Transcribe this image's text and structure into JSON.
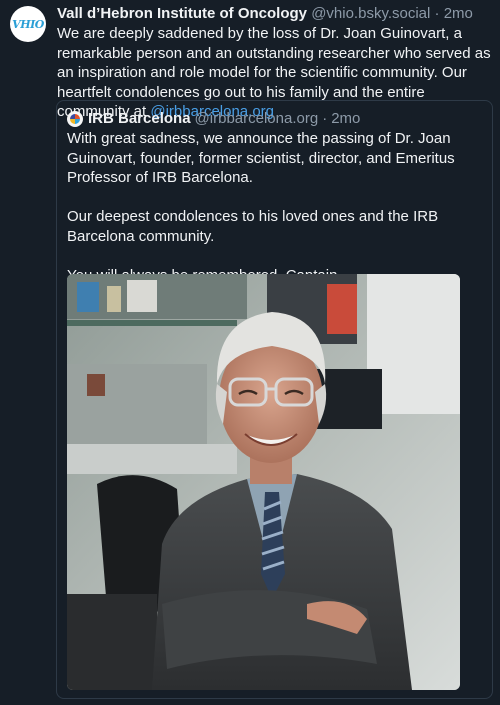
{
  "post": {
    "author": {
      "display_name": "Vall d’Hebron Institute of Oncology",
      "handle": "@vhio.bsky.social",
      "time": "2mo",
      "avatar_text": "VHIO"
    },
    "text_before_mention": "We are deeply saddened by the loss of Dr. Joan Guinovart, a remarkable person and an outstanding researcher who served as an inspiration and role model for the scientific community. Our heartfelt condolences go out to his family and the entire community at ",
    "mention": "@irbbarcelona.org",
    "separator": "·"
  },
  "quote": {
    "author": {
      "display_name": "IRB Barcelona",
      "handle": "@irbbarcelona.org",
      "time": "2mo"
    },
    "paragraphs": [
      "With great sadness, we announce the passing of Dr. Joan Guinovart, founder, former scientist, director, and Emeritus Professor of IRB Barcelona.",
      "Our deepest condolences to his loved ones and the IRB Barcelona community.",
      "You will always be remembered, Captain."
    ],
    "image_icon": "portrait-photo"
  },
  "colors": {
    "background": "#161e27",
    "text": "#f1f3f5",
    "muted": "#8d9aa8",
    "link": "#4a9fe6",
    "border": "#2e3a47"
  }
}
